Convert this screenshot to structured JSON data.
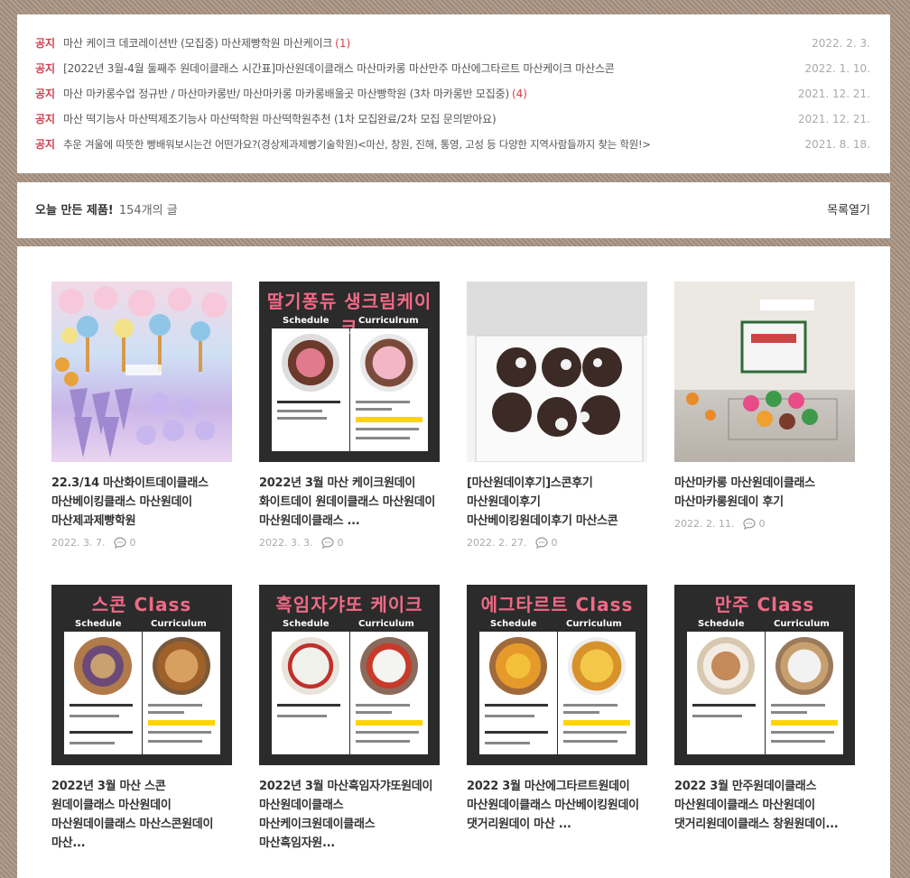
{
  "notices": [
    {
      "badge": "공지",
      "title": "마산 케이크 데코레이션반 (모집중) 마산제빵학원 마산케이크",
      "count": "(1)",
      "date": "2022. 2. 3."
    },
    {
      "badge": "공지",
      "title": "[2022년 3월-4월 둘째주 원데이클래스 시간표]마산원데이클래스 마산마카롱 마산만주 마산에그타르트 마산케이크 마산스콘",
      "count": "",
      "date": "2022. 1. 10."
    },
    {
      "badge": "공지",
      "title": "마산 마카롱수업 정규반 / 마산마카롱반/ 마산마카롱 마카롱배울곳 마산빵학원 (3차 마카롱반 모집중)",
      "count": "(4)",
      "date": "2021. 12. 21."
    },
    {
      "badge": "공지",
      "title": "마산 떡기능사 마산떡제조기능사 마산떡학원 마산떡학원추천 (1차 모집완료/2차 모집 문의받아요)",
      "count": "",
      "date": "2021. 12. 21."
    },
    {
      "badge": "공지",
      "title": "추운 겨울에 따뜻한 빵배워보시는건 어떤가요?(경상제과제빵기술학원)<마산, 창원, 진해, 통영, 고성 등 다양한 지역사람들까지 찾는 학원!>",
      "count": "",
      "date": "2021. 8. 18."
    }
  ],
  "listbar": {
    "title": "오늘 만든 제품!",
    "count": "154개의 글",
    "toggle": "목록열기"
  },
  "cards": [
    {
      "title": "22.3/14 마산화이트데이클래스 마산베이킹클래스 마산원데이 마산제과제빵학원",
      "date": "2022. 3. 7.",
      "comments": "0"
    },
    {
      "title": "2022년 3월 마산 케이크원데이 화이트데이 원데이클래스 마산원데이 마산원데이클래스 ...",
      "date": "2022. 3. 3.",
      "comments": "0",
      "poster": {
        "heading": "딸기퐁듀 생크림케이크",
        "left": "Schedule",
        "right": "Curriculrum"
      }
    },
    {
      "title": "[마산원데이후기]스콘후기 마산원데이후기 마산베이킹원데이후기 마산스콘",
      "date": "2022. 2. 27.",
      "comments": "0"
    },
    {
      "title": "마산마카롱 마산원데이클래스 마산마카롱원데이 후기",
      "date": "2022. 2. 11.",
      "comments": "0"
    },
    {
      "title": "2022년 3월 마산 스콘 원데이클래스 마산원데이 마산원데이클래스 마산스콘원데이 마산...",
      "date": "",
      "comments": "",
      "poster": {
        "heading": "스콘 Class",
        "left": "Schedule",
        "right": "Curriculum"
      }
    },
    {
      "title": "2022년 3월 마산흑임자갸또원데이 마산원데이클래스 마산케이크원데이클래스 마산흑임자원...",
      "date": "",
      "comments": "",
      "poster": {
        "heading": "흑임자갸또 케이크",
        "left": "Schedule",
        "right": "Curriculum"
      }
    },
    {
      "title": "2022 3월 마산에그타르트원데이 마산원데이클래스 마산베이킹원데이 댓거리원데이 마산 ...",
      "date": "",
      "comments": "",
      "poster": {
        "heading": "에그타르트 Class",
        "left": "Schedule",
        "right": "Curriculum"
      }
    },
    {
      "title": "2022 3월 만주원데이클래스 마산원데이클래스 마산원데이 댓거리원데이클래스 창원원데이...",
      "date": "",
      "comments": "",
      "poster": {
        "heading": "만주 Class",
        "left": "Schedule",
        "right": "Curriculum"
      }
    }
  ],
  "colors": {
    "accent": "#d23f4f",
    "poster_heading": "#f06a86",
    "background": "#a89382"
  }
}
